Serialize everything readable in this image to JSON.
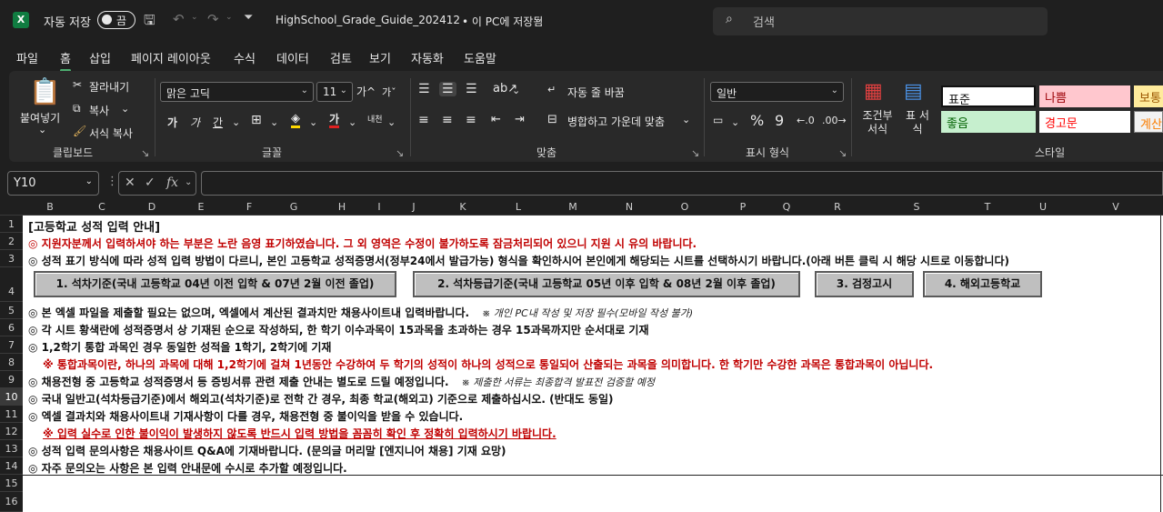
{
  "titlebar": {
    "autosave_label": "자동 저장",
    "autosave_state": "끔",
    "filename": "HighSchool_Grade_Guide_202412",
    "save_location": "• 이 PC에 저장됨",
    "search_placeholder": "검색"
  },
  "menu": [
    "파일",
    "홈",
    "삽입",
    "페이지 레이아웃",
    "수식",
    "데이터",
    "검토",
    "보기",
    "자동화",
    "도움말"
  ],
  "ribbon": {
    "clipboard": {
      "paste": "붙여넣기",
      "cut": "잘라내기",
      "copy": "복사",
      "format_painter": "서식 복사",
      "label": "클립보드"
    },
    "font": {
      "name": "맑은 고딕",
      "size": "11",
      "grow": "가^",
      "shrink": "가ˇ",
      "bold": "가",
      "italic": "가",
      "underline": "간",
      "font_color": "가",
      "label": "글꼴"
    },
    "alignment": {
      "wrap": "자동 줄 바꿈",
      "merge": "병합하고 가운데 맞춤",
      "label": "맞춤"
    },
    "number": {
      "format": "일반",
      "percent": "%",
      "comma": "9",
      "label": "표시 형식"
    },
    "styles": {
      "conditional": "조건부 서식",
      "table": "표 서식",
      "cells": [
        "표준",
        "나쁨",
        "보통",
        "좋음",
        "경고문",
        "계산"
      ],
      "label": "스타일"
    }
  },
  "formula": {
    "name_box": "Y10",
    "value": ""
  },
  "columns": [
    "B",
    "C",
    "D",
    "E",
    "F",
    "G",
    "H",
    "I",
    "J",
    "K",
    "L",
    "M",
    "N",
    "O",
    "P",
    "Q",
    "R",
    "S",
    "T",
    "U",
    "V"
  ],
  "rows": [
    "1",
    "2",
    "3",
    "4",
    "5",
    "6",
    "7",
    "8",
    "9",
    "10",
    "11",
    "12",
    "13",
    "14",
    "15",
    "16"
  ],
  "sheet": {
    "title": "[고등학교 성적 입력 안내]",
    "r2": "◎  지원자분께서 입력하셔야 하는 부분은 노란 음영 표기하였습니다. 그 외 영역은 수정이 불가하도록 잠금처리되어 있으니 지원 시 유의 바랍니다.",
    "r3": "◎  성적 표기 방식에 따라 성적 입력 방법이 다르니, 본인 고등학교 성적증명서(정부24에서 발급가능) 형식을 확인하시어 본인에게 해당되는 시트를 선택하시기 바랍니다.(아래 버튼 클릭 시 해당 시트로 이동합니다)",
    "buttons": [
      "1. 석차기준(국내 고등학교 04년 이전 입학 & 07년 2월 이전 졸업)",
      "2. 석차등급기준(국내 고등학교 05년 이후 입학 & 08년 2월 이후 졸업)",
      "3. 검정고시",
      "4. 해외고등학교"
    ],
    "r5": "◎  본 엑셀 파일을 제출할 필요는 없으며, 엑셀에서 계산된 결과치만 채용사이트내 입력바랍니다.",
    "r5_note": "※ 개인 PC내 작성 및 저장 필수(모바일 작성 불가)",
    "r6": "◎  각 시트 황색란에 성적증명서 상 기재된 순으로 작성하되, 한 학기 이수과목이 15과목을 초과하는 경우 15과목까지만 순서대로 기재",
    "r7": "◎  1,2학기 통합 과목인 경우 동일한 성적을 1학기, 2학기에 기재",
    "r8": "※ 통합과목이란, 하나의 과목에 대해 1,2학기에 걸쳐 1년동안 수강하여 두 학기의 성적이 하나의 성적으로 통일되어 산출되는 과목을 의미합니다. 한 학기만 수강한 과목은 통합과목이 아닙니다.",
    "r9": "◎  채용전형 중 고등학교 성적증명서 등 증빙서류 관련 제출 안내는 별도로 드릴 예정입니다.",
    "r9_note": "※ 제출한 서류는 최종합격 발표전 검증할 예정",
    "r10": "◎  국내 일반고(석차등급기준)에서 해외고(석차기준)로 전학 간 경우, 최종 학교(해외고) 기준으로 제출하십시오. (반대도 동일)",
    "r11": "◎  엑셀 결과치와 채용사이트내 기재사항이 다를 경우, 채용전형 중 불이익을 받을 수 있습니다.",
    "r12": "※ 입력 실수로 인한 불이익이 발생하지 않도록 반드시 입력 방법을 꼼꼼히 확인 후 정확히 입력하시기 바랍니다.",
    "r13": "◎  성적 입력 문의사항은 채용사이트 Q&A에 기재바랍니다. (문의글 머리말 [엔지니어 채용] 기재 요망)",
    "r14": "◎  자주 문의오는 사항은 본 입력 안내문에 수시로 추가할 예정입니다."
  }
}
